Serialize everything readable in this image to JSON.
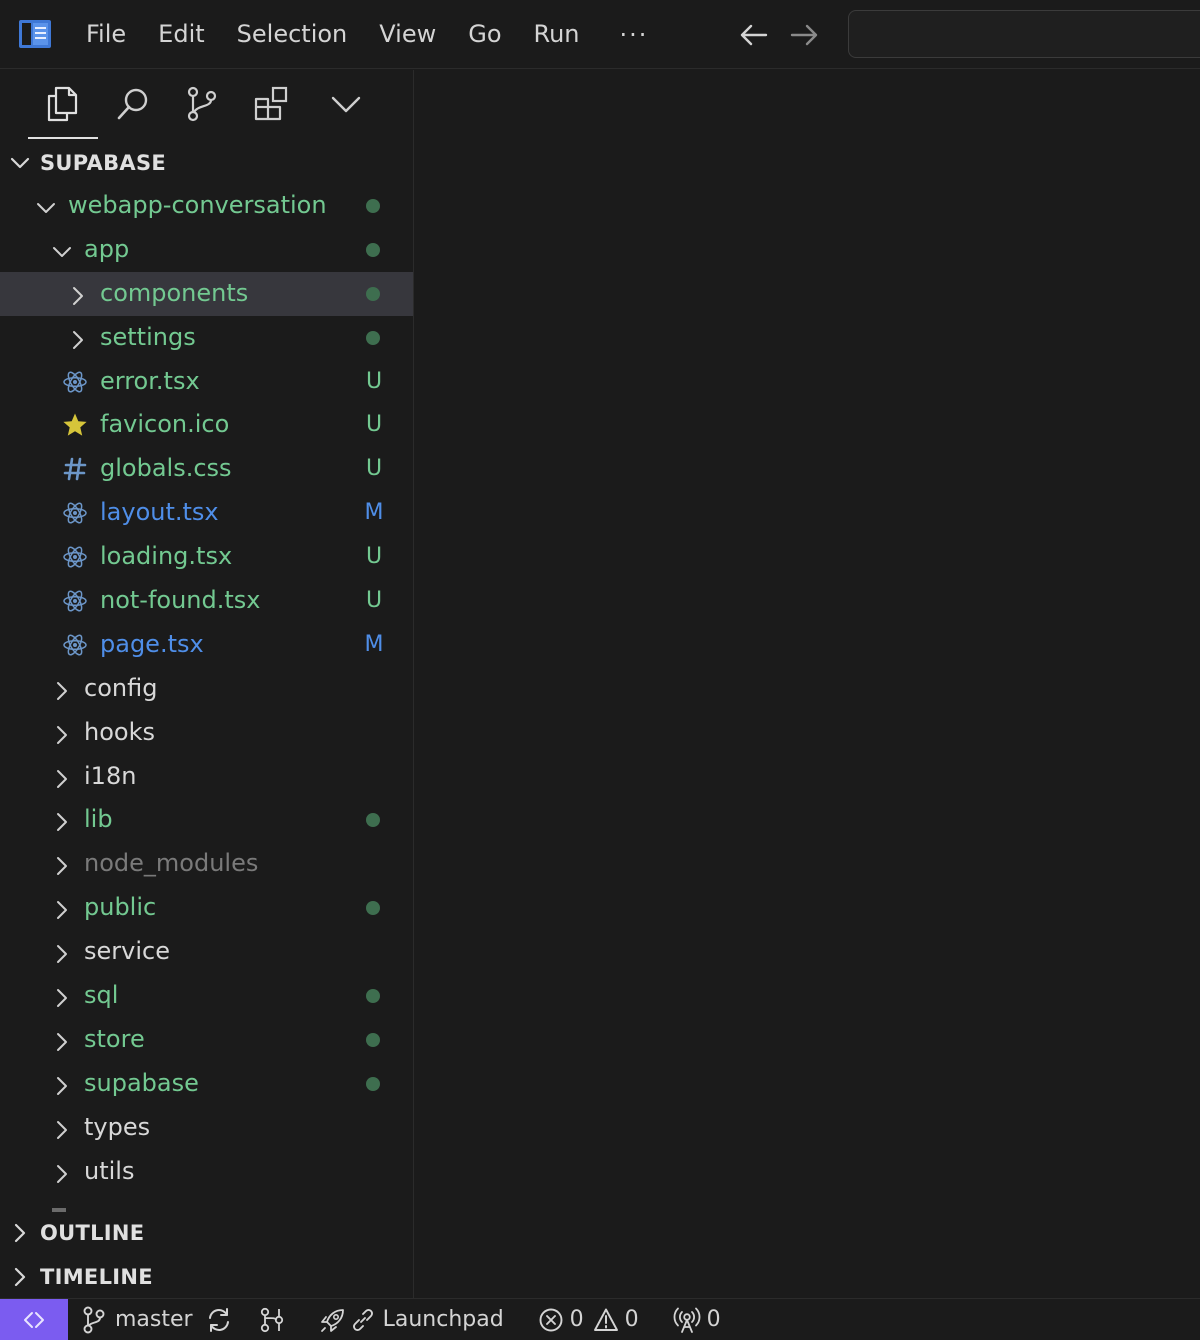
{
  "menu": {
    "items": [
      "File",
      "Edit",
      "Selection",
      "View",
      "Go",
      "Run"
    ],
    "more": "···"
  },
  "explorer": {
    "section_title": "SUPABASE",
    "tree": [
      {
        "label": "webapp-conversation",
        "kind": "folder",
        "expanded": true,
        "depth": 1,
        "color": "green",
        "decoration": "dot"
      },
      {
        "label": "app",
        "kind": "folder",
        "expanded": true,
        "depth": 2,
        "color": "green",
        "decoration": "dot"
      },
      {
        "label": "components",
        "kind": "folder",
        "expanded": false,
        "depth": 3,
        "color": "green",
        "decoration": "dot",
        "selected": true
      },
      {
        "label": "settings",
        "kind": "folder",
        "expanded": false,
        "depth": 3,
        "color": "green",
        "decoration": "dot"
      },
      {
        "label": "error.tsx",
        "kind": "file",
        "icon": "react-icon",
        "depth": 3,
        "color": "green",
        "decoration": "U"
      },
      {
        "label": "favicon.ico",
        "kind": "file",
        "icon": "star-icon",
        "depth": 3,
        "color": "green",
        "decoration": "U"
      },
      {
        "label": "globals.css",
        "kind": "file",
        "icon": "hash-icon",
        "depth": 3,
        "color": "green",
        "decoration": "U"
      },
      {
        "label": "layout.tsx",
        "kind": "file",
        "icon": "react-icon",
        "depth": 3,
        "color": "blue",
        "decoration": "M"
      },
      {
        "label": "loading.tsx",
        "kind": "file",
        "icon": "react-icon",
        "depth": 3,
        "color": "green",
        "decoration": "U"
      },
      {
        "label": "not-found.tsx",
        "kind": "file",
        "icon": "react-icon",
        "depth": 3,
        "color": "green",
        "decoration": "U"
      },
      {
        "label": "page.tsx",
        "kind": "file",
        "icon": "react-icon",
        "depth": 3,
        "color": "blue",
        "decoration": "M"
      },
      {
        "label": "config",
        "kind": "folder",
        "expanded": false,
        "depth": 2,
        "color": "white",
        "decoration": ""
      },
      {
        "label": "hooks",
        "kind": "folder",
        "expanded": false,
        "depth": 2,
        "color": "white",
        "decoration": ""
      },
      {
        "label": "i18n",
        "kind": "folder",
        "expanded": false,
        "depth": 2,
        "color": "white",
        "decoration": ""
      },
      {
        "label": "lib",
        "kind": "folder",
        "expanded": false,
        "depth": 2,
        "color": "green",
        "decoration": "dot"
      },
      {
        "label": "node_modules",
        "kind": "folder",
        "expanded": false,
        "depth": 2,
        "color": "gray",
        "decoration": ""
      },
      {
        "label": "public",
        "kind": "folder",
        "expanded": false,
        "depth": 2,
        "color": "green",
        "decoration": "dot"
      },
      {
        "label": "service",
        "kind": "folder",
        "expanded": false,
        "depth": 2,
        "color": "white",
        "decoration": ""
      },
      {
        "label": "sql",
        "kind": "folder",
        "expanded": false,
        "depth": 2,
        "color": "green",
        "decoration": "dot"
      },
      {
        "label": "store",
        "kind": "folder",
        "expanded": false,
        "depth": 2,
        "color": "green",
        "decoration": "dot"
      },
      {
        "label": "supabase",
        "kind": "folder",
        "expanded": false,
        "depth": 2,
        "color": "green",
        "decoration": "dot"
      },
      {
        "label": "types",
        "kind": "folder",
        "expanded": false,
        "depth": 2,
        "color": "white",
        "decoration": ""
      },
      {
        "label": "utils",
        "kind": "folder",
        "expanded": false,
        "depth": 2,
        "color": "white",
        "decoration": ""
      }
    ]
  },
  "panels": {
    "outline": "OUTLINE",
    "timeline": "TIMELINE"
  },
  "statusbar": {
    "branch": "master",
    "launchpad": "Launchpad",
    "errors": "0",
    "warnings": "0",
    "ports": "0"
  },
  "colors": {
    "accent_remote": "#7b5cf0",
    "git_untracked": "#73c991",
    "git_modified": "#4f8ee8",
    "background": "#1b1b1b",
    "selection": "#37373d"
  }
}
